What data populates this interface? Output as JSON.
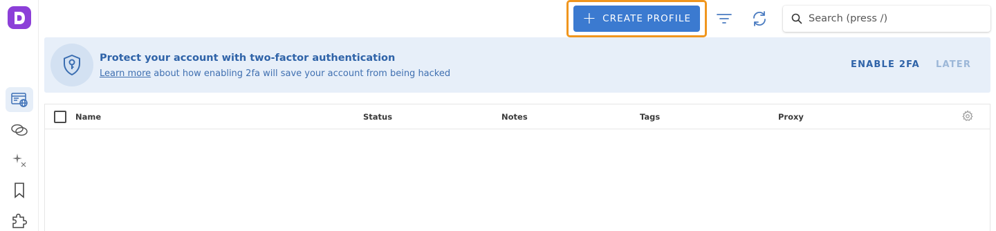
{
  "sidebar": {
    "logo_letter": "D",
    "items": [
      {
        "icon": "browser-profiles-icon",
        "active": true
      },
      {
        "icon": "links-icon",
        "active": false
      },
      {
        "icon": "sparkle-x-icon",
        "active": false
      },
      {
        "icon": "bookmark-icon",
        "active": false
      },
      {
        "icon": "puzzle-extension-icon",
        "active": false
      }
    ]
  },
  "toolbar": {
    "create_label": "CREATE PROFILE",
    "filter_icon": "filter-icon",
    "refresh_icon": "refresh-icon",
    "search_placeholder": "Search (press /)"
  },
  "banner": {
    "title": "Protect your account with two-factor authentication",
    "link_text": "Learn more",
    "subtitle_rest": " about how enabling 2fa will save your account from being hacked",
    "enable_label": "ENABLE 2FA",
    "later_label": "LATER"
  },
  "table": {
    "columns": [
      "Name",
      "Status",
      "Notes",
      "Tags",
      "Proxy"
    ],
    "rows": []
  },
  "colors": {
    "brand": "#8c3fd8",
    "primary": "#3b7ad0",
    "highlight": "#f0961e",
    "banner_bg": "#e7eff9"
  }
}
